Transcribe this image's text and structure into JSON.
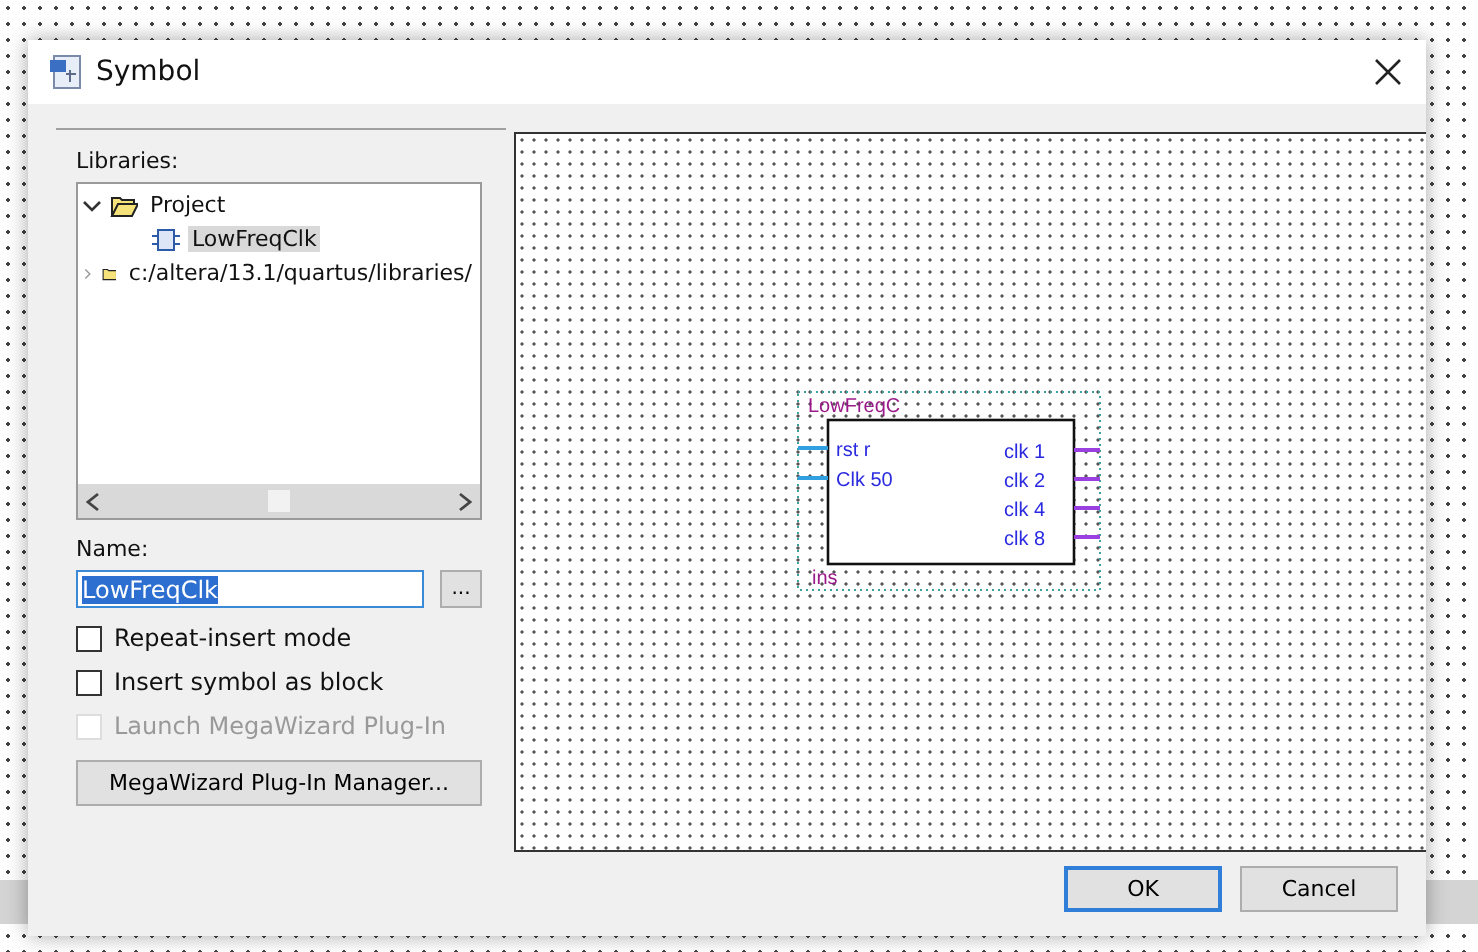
{
  "window": {
    "title": "Symbol"
  },
  "libraries": {
    "label": "Libraries:",
    "tree": [
      {
        "label": "Project",
        "expanded": true,
        "children": [
          {
            "label": "LowFreqClk",
            "selected": true
          }
        ]
      },
      {
        "label": "c:/altera/13.1/quartus/libraries/",
        "expanded": false
      }
    ]
  },
  "name": {
    "label": "Name:",
    "value": "LowFreqClk",
    "browse": "..."
  },
  "options": [
    {
      "label": "Repeat-insert mode",
      "checked": false,
      "disabled": false
    },
    {
      "label": "Insert symbol as block",
      "checked": false,
      "disabled": false
    },
    {
      "label": "Launch MegaWizard Plug-In",
      "checked": false,
      "disabled": true
    }
  ],
  "manager_button": "MegaWizard Plug-In Manager...",
  "preview": {
    "symbol": {
      "name": "LowFreqC",
      "instance": "ins",
      "inputs": [
        "rst r",
        "Clk 50"
      ],
      "outputs": [
        "clk 1",
        "clk 2",
        "clk 4",
        "clk 8"
      ]
    }
  },
  "buttons": [
    {
      "label": "OK",
      "default": true
    },
    {
      "label": "Cancel",
      "default": false
    }
  ]
}
